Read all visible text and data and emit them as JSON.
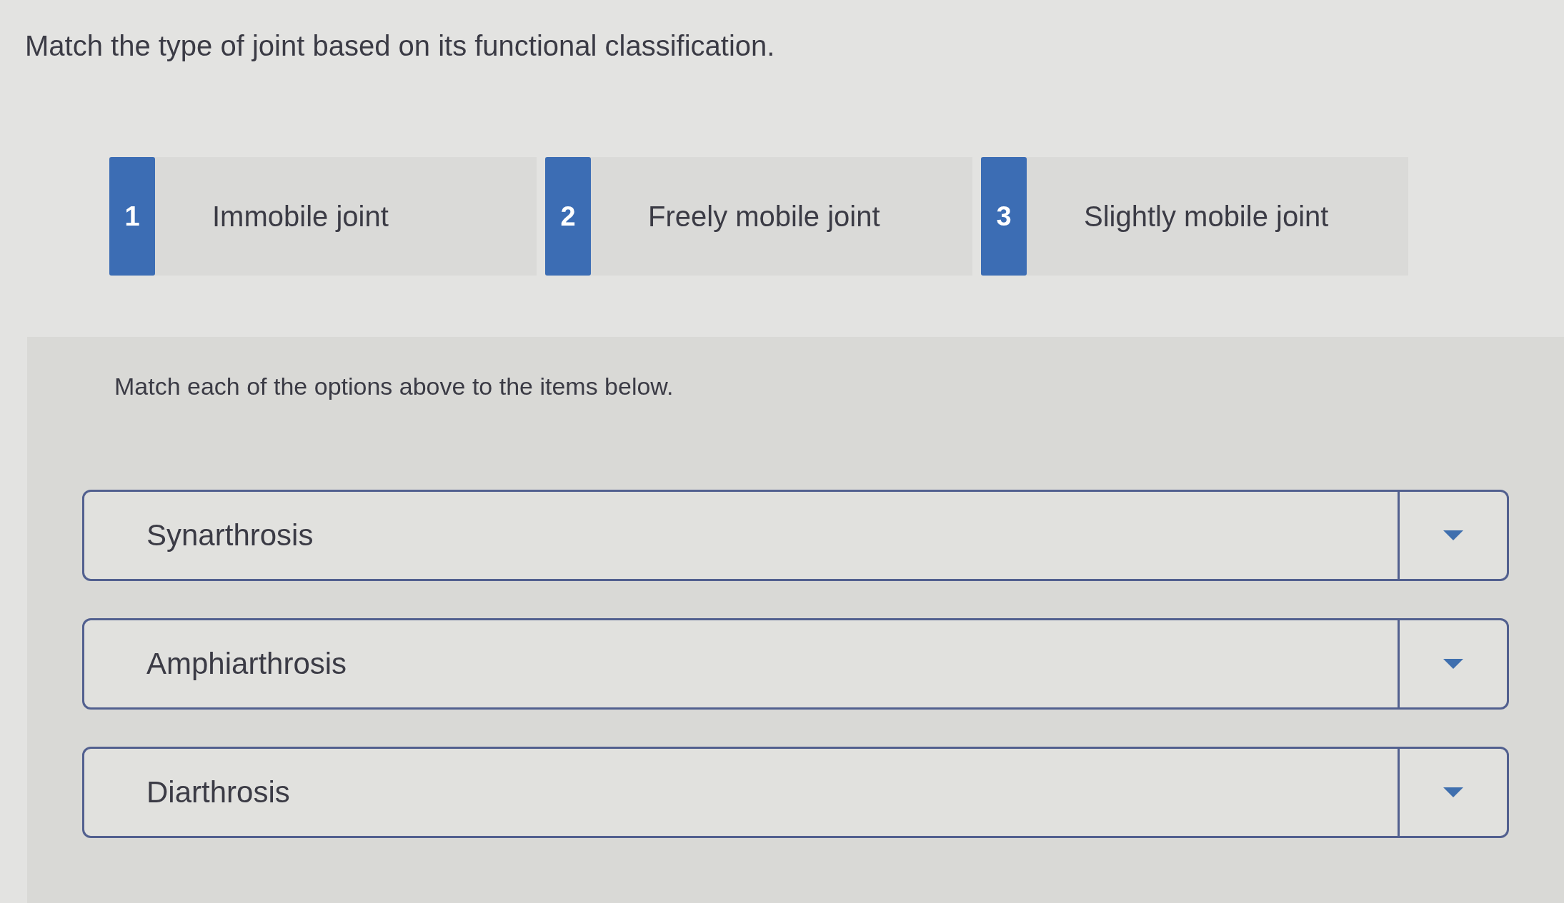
{
  "instruction": "Match the type of joint based on its functional classification.",
  "options": [
    {
      "number": "1",
      "label": "Immobile joint"
    },
    {
      "number": "2",
      "label": "Freely mobile joint"
    },
    {
      "number": "3",
      "label": "Slightly mobile joint"
    }
  ],
  "matching": {
    "prompt": "Match each of the options above to the items below.",
    "items": [
      {
        "label": "Synarthrosis"
      },
      {
        "label": "Amphiarthrosis"
      },
      {
        "label": "Diarthrosis"
      }
    ]
  }
}
